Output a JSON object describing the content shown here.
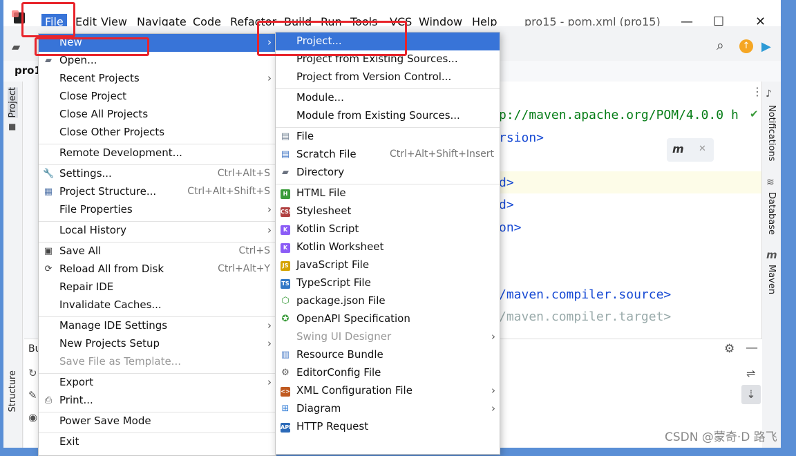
{
  "menubar": {
    "items": [
      "File",
      "Edit",
      "View",
      "Navigate",
      "Code",
      "Refactor",
      "Build",
      "Run",
      "Tools",
      "VCS",
      "Window",
      "Help"
    ],
    "window_title": "pro15 - pom.xml (pro15)"
  },
  "window_controls": {
    "minimize": "—",
    "maximize": "☐",
    "close": "✕"
  },
  "tab": {
    "project_name": "pro1"
  },
  "left_strip": {
    "project": "Project",
    "structure": "Structure"
  },
  "right_strip": {
    "notifications": "Notifications",
    "database": "Database",
    "maven": "Maven"
  },
  "bottom_panel": {
    "title_fragment": "Bu"
  },
  "editor": {
    "lines": [
      {
        "text": "p://maven.apache.org/POM/4.0.0 h"
      },
      {
        "text": "rsion>"
      },
      {
        "text": "d>"
      },
      {
        "text": "d>"
      },
      {
        "text": "on>"
      },
      {
        "text": "/maven.compiler.source>"
      },
      {
        "text": "/maven.compiler.target>"
      }
    ]
  },
  "file_menu": [
    {
      "label": "New",
      "submenu": true,
      "selected": true
    },
    {
      "label": "Open...",
      "icon": "folder-icon"
    },
    {
      "label": "Recent Projects",
      "submenu": true
    },
    {
      "label": "Close Project"
    },
    {
      "label": "Close All Projects"
    },
    {
      "label": "Close Other Projects"
    },
    {
      "sep": true
    },
    {
      "label": "Remote Development..."
    },
    {
      "sep": true
    },
    {
      "label": "Settings...",
      "shortcut": "Ctrl+Alt+S",
      "icon": "wrench-icon"
    },
    {
      "label": "Project Structure...",
      "shortcut": "Ctrl+Alt+Shift+S",
      "icon": "project-structure-icon"
    },
    {
      "label": "File Properties",
      "submenu": true
    },
    {
      "sep": true
    },
    {
      "label": "Local History",
      "submenu": true
    },
    {
      "sep": true
    },
    {
      "label": "Save All",
      "shortcut": "Ctrl+S",
      "icon": "save-icon"
    },
    {
      "label": "Reload All from Disk",
      "shortcut": "Ctrl+Alt+Y",
      "icon": "reload-icon"
    },
    {
      "label": "Repair IDE"
    },
    {
      "label": "Invalidate Caches..."
    },
    {
      "sep": true
    },
    {
      "label": "Manage IDE Settings",
      "submenu": true
    },
    {
      "label": "New Projects Setup",
      "submenu": true
    },
    {
      "label": "Save File as Template...",
      "disabled": true
    },
    {
      "sep": true
    },
    {
      "label": "Export",
      "submenu": true
    },
    {
      "label": "Print...",
      "icon": "print-icon"
    },
    {
      "sep": true
    },
    {
      "label": "Power Save Mode"
    },
    {
      "sep": true
    },
    {
      "label": "Exit"
    }
  ],
  "new_menu": [
    {
      "label": "Project...",
      "selected": true
    },
    {
      "label": "Project from Existing Sources..."
    },
    {
      "label": "Project from Version Control..."
    },
    {
      "sep": true
    },
    {
      "label": "Module..."
    },
    {
      "label": "Module from Existing Sources..."
    },
    {
      "sep": true
    },
    {
      "label": "File",
      "icon": "file-icon"
    },
    {
      "label": "Scratch File",
      "shortcut": "Ctrl+Alt+Shift+Insert",
      "icon": "scratch-file-icon"
    },
    {
      "label": "Directory",
      "icon": "folder-icon"
    },
    {
      "sep": true
    },
    {
      "label": "HTML File",
      "icon": "html-file-icon"
    },
    {
      "label": "Stylesheet",
      "icon": "css-file-icon"
    },
    {
      "label": "Kotlin Script",
      "icon": "kotlin-script-icon"
    },
    {
      "label": "Kotlin Worksheet",
      "icon": "kotlin-worksheet-icon"
    },
    {
      "label": "JavaScript File",
      "icon": "javascript-file-icon"
    },
    {
      "label": "TypeScript File",
      "icon": "typescript-file-icon"
    },
    {
      "label": "package.json File",
      "icon": "nodejs-icon"
    },
    {
      "label": "OpenAPI Specification",
      "icon": "openapi-icon"
    },
    {
      "label": "Swing UI Designer",
      "submenu": true,
      "disabled": true
    },
    {
      "label": "Resource Bundle",
      "icon": "resource-bundle-icon"
    },
    {
      "label": "EditorConfig File",
      "icon": "editorconfig-icon"
    },
    {
      "label": "XML Configuration File",
      "submenu": true,
      "icon": "xml-icon"
    },
    {
      "label": "Diagram",
      "submenu": true,
      "icon": "diagram-icon"
    },
    {
      "label": "HTTP Request",
      "icon": "api-icon"
    }
  ],
  "watermark": "CSDN @蒙奇·D 路飞",
  "colors": {
    "selection": "#3874d8",
    "highlight": "#e8242b"
  }
}
